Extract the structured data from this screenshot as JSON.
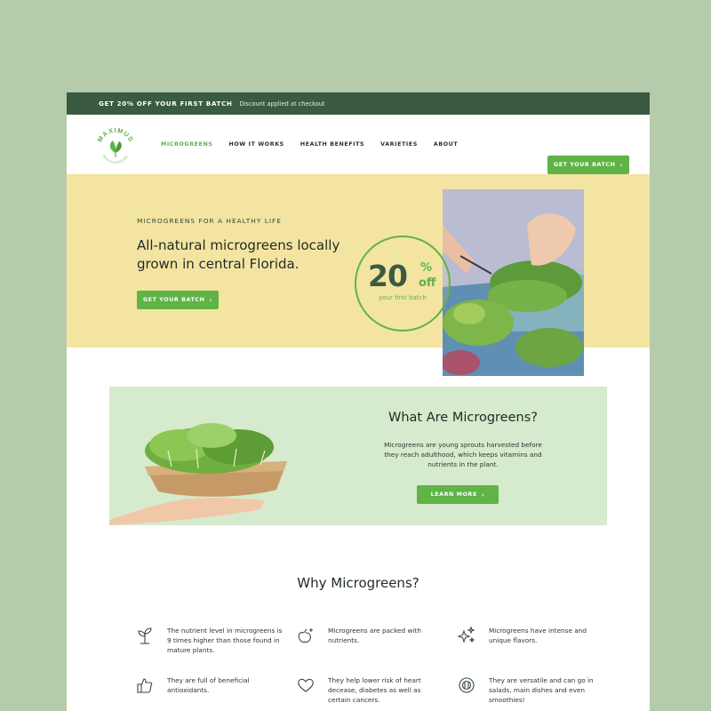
{
  "promo": {
    "headline": "GET 20% OFF YOUR FIRST BATCH",
    "note": "Discount applied at checkout"
  },
  "logo": {
    "brand": "MAXIMUS",
    "sub": "MICROGREENS"
  },
  "nav": {
    "items": [
      {
        "label": "MICROGREENS",
        "active": true
      },
      {
        "label": "HOW IT WORKS",
        "active": false
      },
      {
        "label": "HEALTH BENEFITS",
        "active": false
      },
      {
        "label": "VARIETIES",
        "active": false
      },
      {
        "label": "ABOUT",
        "active": false
      }
    ],
    "cta_label": "GET YOUR BATCH",
    "cta_icon": "chevron-right-icon"
  },
  "hero": {
    "eyebrow": "MICROGREENS FOR A HEALTHY LIFE",
    "headline": "All-natural microgreens locally grown in central Florida.",
    "cta_label": "GET YOUR BATCH",
    "badge": {
      "number": "20",
      "percent": "%",
      "off": "off",
      "caption": "your first batch"
    }
  },
  "what": {
    "title": "What Are Microgreens?",
    "body": "Microgreens are young sprouts harvested before they reach adulthood, which keeps vitamins and nutrients in the plant.",
    "cta_label": "LEARN MORE"
  },
  "why": {
    "title": "Why Microgreens?",
    "features": [
      {
        "icon": "sprout-icon",
        "text": "The nutrient level in microgreens is 9 times higher than those found in mature plants."
      },
      {
        "icon": "apple-sparkle-icon",
        "text": "Microgreens are packed with nutrients."
      },
      {
        "icon": "sparkles-icon",
        "text": "Microgreens have intense and unique flavors."
      },
      {
        "icon": "thumbs-up-icon",
        "text": "They are full of beneficial antioxidants."
      },
      {
        "icon": "heart-icon",
        "text": "They help lower risk of heart decease, diabetes as well as certain cancers."
      },
      {
        "icon": "plate-cutlery-icon",
        "text": "They are versatile and can go in salads, main dishes and even smoothies!"
      }
    ]
  },
  "colors": {
    "brand_green": "#60b346",
    "dark_green": "#3a5a42",
    "hero_bg": "#f4e4a2",
    "section_bg": "#d6eacd",
    "page_bg": "#b5cbaa"
  }
}
